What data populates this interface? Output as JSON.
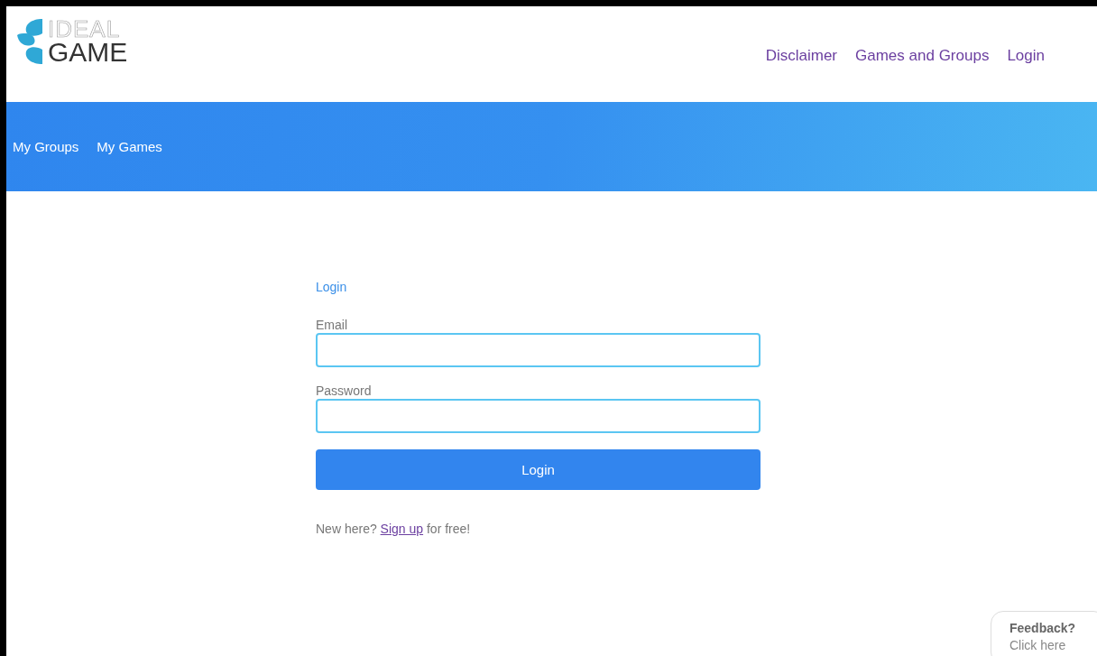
{
  "logo": {
    "line_1": "IDEAL",
    "line_2": "GAME"
  },
  "top_nav": [
    {
      "label": "Disclaimer"
    },
    {
      "label": "Games and Groups"
    },
    {
      "label": "Login"
    }
  ],
  "banner_nav": [
    {
      "label": "My Groups"
    },
    {
      "label": "My Games"
    }
  ],
  "form": {
    "heading": "Login",
    "fields": [
      {
        "label": "Email"
      },
      {
        "label": "Password"
      }
    ],
    "submit": "Login",
    "signup": {
      "before": "New here?",
      "link": "Sign up",
      "after": "for free!"
    }
  },
  "feedback": {
    "title": "Feedback?",
    "subtitle": "Click here"
  }
}
